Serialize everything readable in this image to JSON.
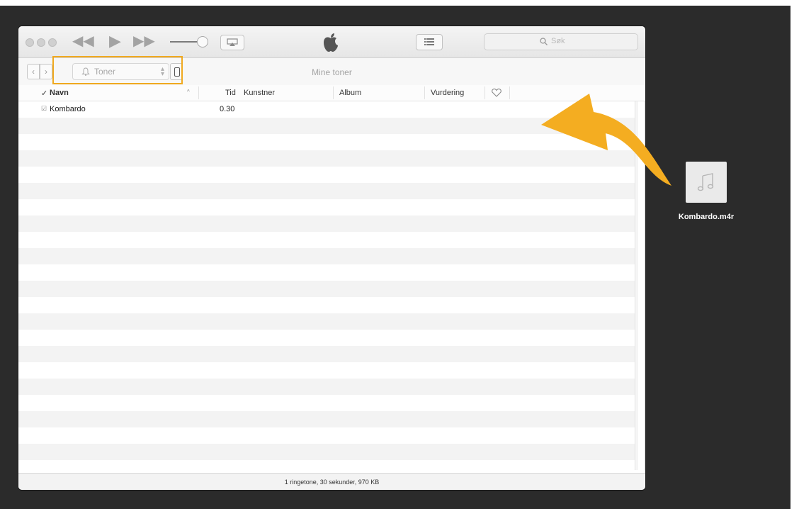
{
  "navigation": {
    "source_select": "Toner",
    "section_title": "Mine toner"
  },
  "search": {
    "placeholder": "Søk"
  },
  "columns": {
    "check": "✓",
    "name": "Navn",
    "time": "Tid",
    "artist": "Kunstner",
    "album": "Album",
    "rating": "Vurdering"
  },
  "songs": [
    {
      "checked": true,
      "name": "Kombardo",
      "time": "0.30",
      "artist": "",
      "album": ""
    }
  ],
  "status": "1 ringetone, 30 sekunder, 970 KB",
  "desktop_file": {
    "name": "Kombardo.m4r",
    "icon": "music-note-icon"
  },
  "colors": {
    "highlight": "#f0a91f",
    "arrow": "#f4ad21"
  }
}
